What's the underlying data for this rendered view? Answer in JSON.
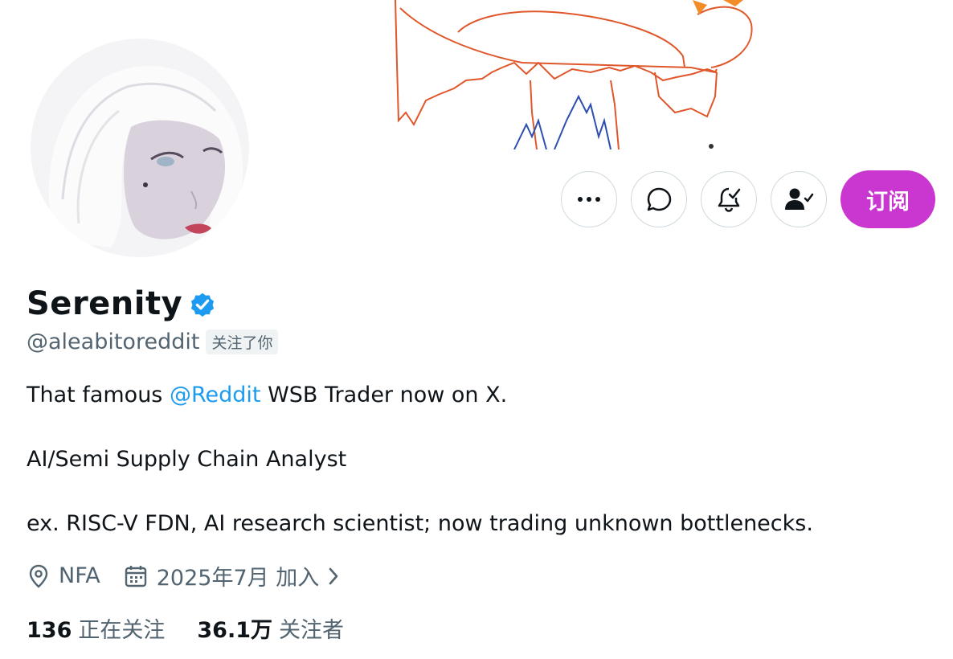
{
  "profile": {
    "name": "Serenity",
    "handle": "@aleabitoreddit",
    "follows_you": "关注了你",
    "verified": true
  },
  "bio": {
    "line1_prefix": "That famous ",
    "line1_mention": "@Reddit",
    "line1_suffix": " WSB Trader now on X.",
    "line2": "AI/Semi Supply Chain Analyst",
    "line3": "ex. RISC-V FDN, AI research scientist; now trading unknown bottlenecks."
  },
  "meta": {
    "location": "NFA",
    "joined": "2025年7月 加入"
  },
  "stats": {
    "following_count": "136",
    "following_label": "正在关注",
    "followers_count": "36.1万",
    "followers_label": "关注者"
  },
  "actions": {
    "subscribe_label": "订阅",
    "icons": [
      "more-icon",
      "message-icon",
      "notification-bell-icon",
      "following-user-icon"
    ]
  },
  "colors": {
    "accent": "#1d9bf0",
    "subscribe": "#c936d0",
    "secondary_text": "#536471",
    "border": "#cfd9de"
  }
}
